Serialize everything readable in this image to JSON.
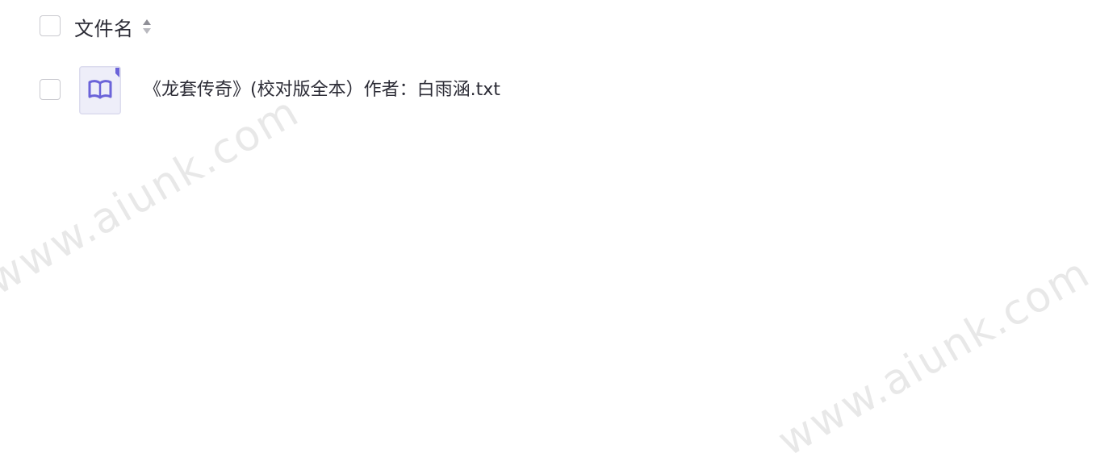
{
  "header": {
    "select_all_checked": false,
    "column_title": "文件名",
    "sort_icon": "sort-icon"
  },
  "files": [
    {
      "name": "《龙套传奇》(校对版全本）作者：白雨涵.txt",
      "icon": "book-file-icon",
      "checked": false
    }
  ],
  "watermarks": [
    "www.aiunk.com",
    "www.aiunk.com"
  ],
  "colors": {
    "text": "#2c2c36",
    "checkbox_border": "#c9c9cf",
    "file_icon_bg": "#eeeef9",
    "file_icon_accent": "#6b63d9",
    "sort_icon": "#9a9aa2"
  }
}
